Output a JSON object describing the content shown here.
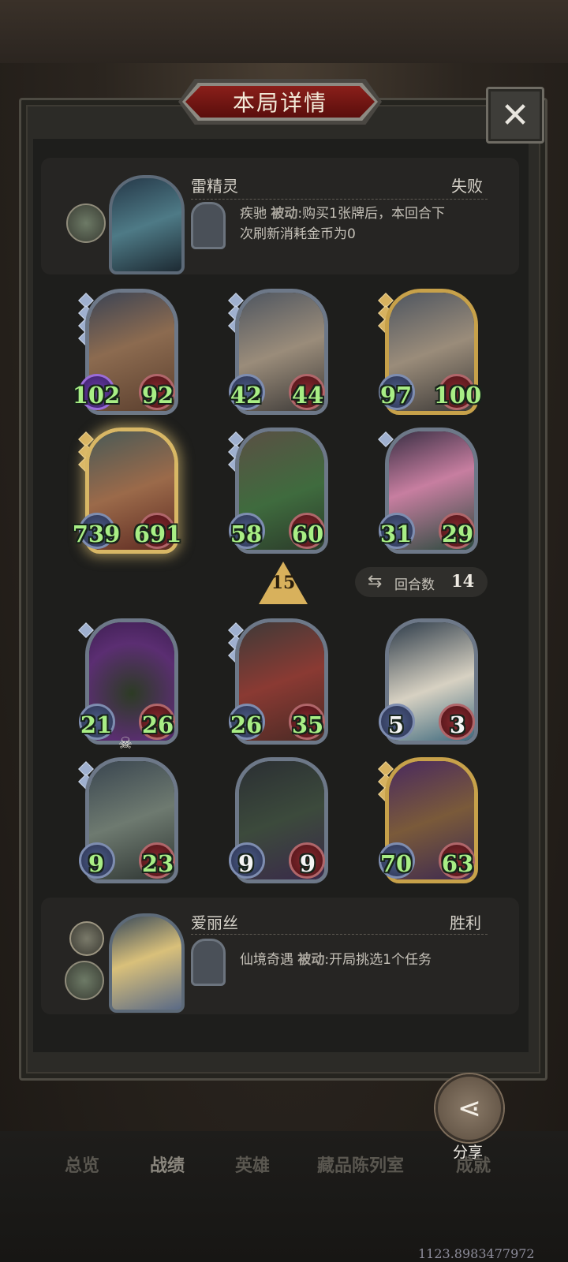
{
  "title": "本局详情",
  "close_icon": "close-icon",
  "top_player": {
    "name": "雷精灵",
    "result": "失败",
    "skill_name": "疾驰",
    "skill_type": "被动",
    "skill_desc_line1": ":购买1张牌后，本回合下",
    "skill_desc_line2": "次刷新消耗金币为0"
  },
  "bottom_player": {
    "name": "爱丽丝",
    "result": "胜利",
    "skill_name": "仙境奇遇",
    "skill_type": "被动",
    "skill_desc_line1": ":开局挑选1个任务"
  },
  "opponent_cards": [
    {
      "atk": "102",
      "hp": "92"
    },
    {
      "atk": "42",
      "hp": "44"
    },
    {
      "atk": "97",
      "hp": "100"
    },
    {
      "atk": "739",
      "hp": "691"
    },
    {
      "atk": "58",
      "hp": "60"
    },
    {
      "atk": "31",
      "hp": "29"
    }
  ],
  "tier": "15",
  "rounds_label": "回合数",
  "rounds_value": "14",
  "player_cards": [
    {
      "atk": "21",
      "hp": "26"
    },
    {
      "atk": "26",
      "hp": "35"
    },
    {
      "atk": "5",
      "hp": "3"
    },
    {
      "atk": "9",
      "hp": "23"
    },
    {
      "atk": "9",
      "hp": "9"
    },
    {
      "atk": "70",
      "hp": "63"
    }
  ],
  "share_label": "分享",
  "nav": [
    "总览",
    "战绩",
    "英雄",
    "藏品陈列室",
    "成就"
  ],
  "coords_text": "1123.8983477972"
}
